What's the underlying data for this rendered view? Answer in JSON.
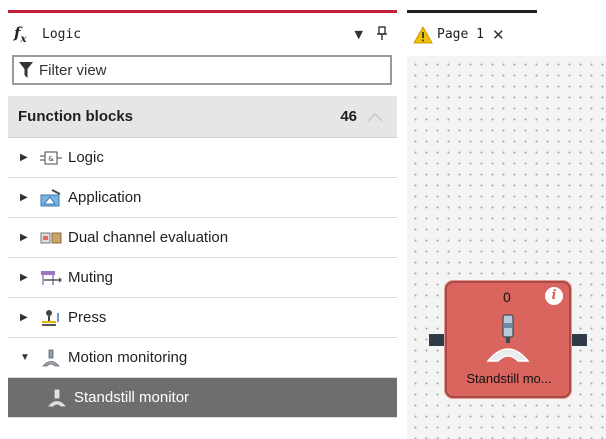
{
  "panel": {
    "icon": "function-fx-icon",
    "title": "Logic",
    "filter_placeholder": "Filter view"
  },
  "section": {
    "title": "Function blocks",
    "count": "46"
  },
  "tree": {
    "items": [
      {
        "label": "Logic",
        "expanded": false,
        "icon": "logic-block-icon"
      },
      {
        "label": "Application",
        "expanded": false,
        "icon": "application-icon"
      },
      {
        "label": "Dual channel evaluation",
        "expanded": false,
        "icon": "dual-channel-icon"
      },
      {
        "label": "Muting",
        "expanded": false,
        "icon": "muting-icon"
      },
      {
        "label": "Press",
        "expanded": false,
        "icon": "press-icon"
      },
      {
        "label": "Motion monitoring",
        "expanded": true,
        "icon": "motion-monitoring-icon"
      },
      {
        "label": "Standstill monitor",
        "child": true,
        "selected": true,
        "icon": "standstill-monitor-icon"
      }
    ]
  },
  "tab": {
    "label": "Page 1",
    "close": "✕",
    "warning_icon": "warning-icon"
  },
  "block": {
    "count": "0",
    "info": "i",
    "label": "Standstill mo...",
    "color": "#d9655e"
  },
  "colors": {
    "accent": "#c5203a",
    "selected_row": "#6e6e6e",
    "section_bg": "#e6e6e6"
  }
}
